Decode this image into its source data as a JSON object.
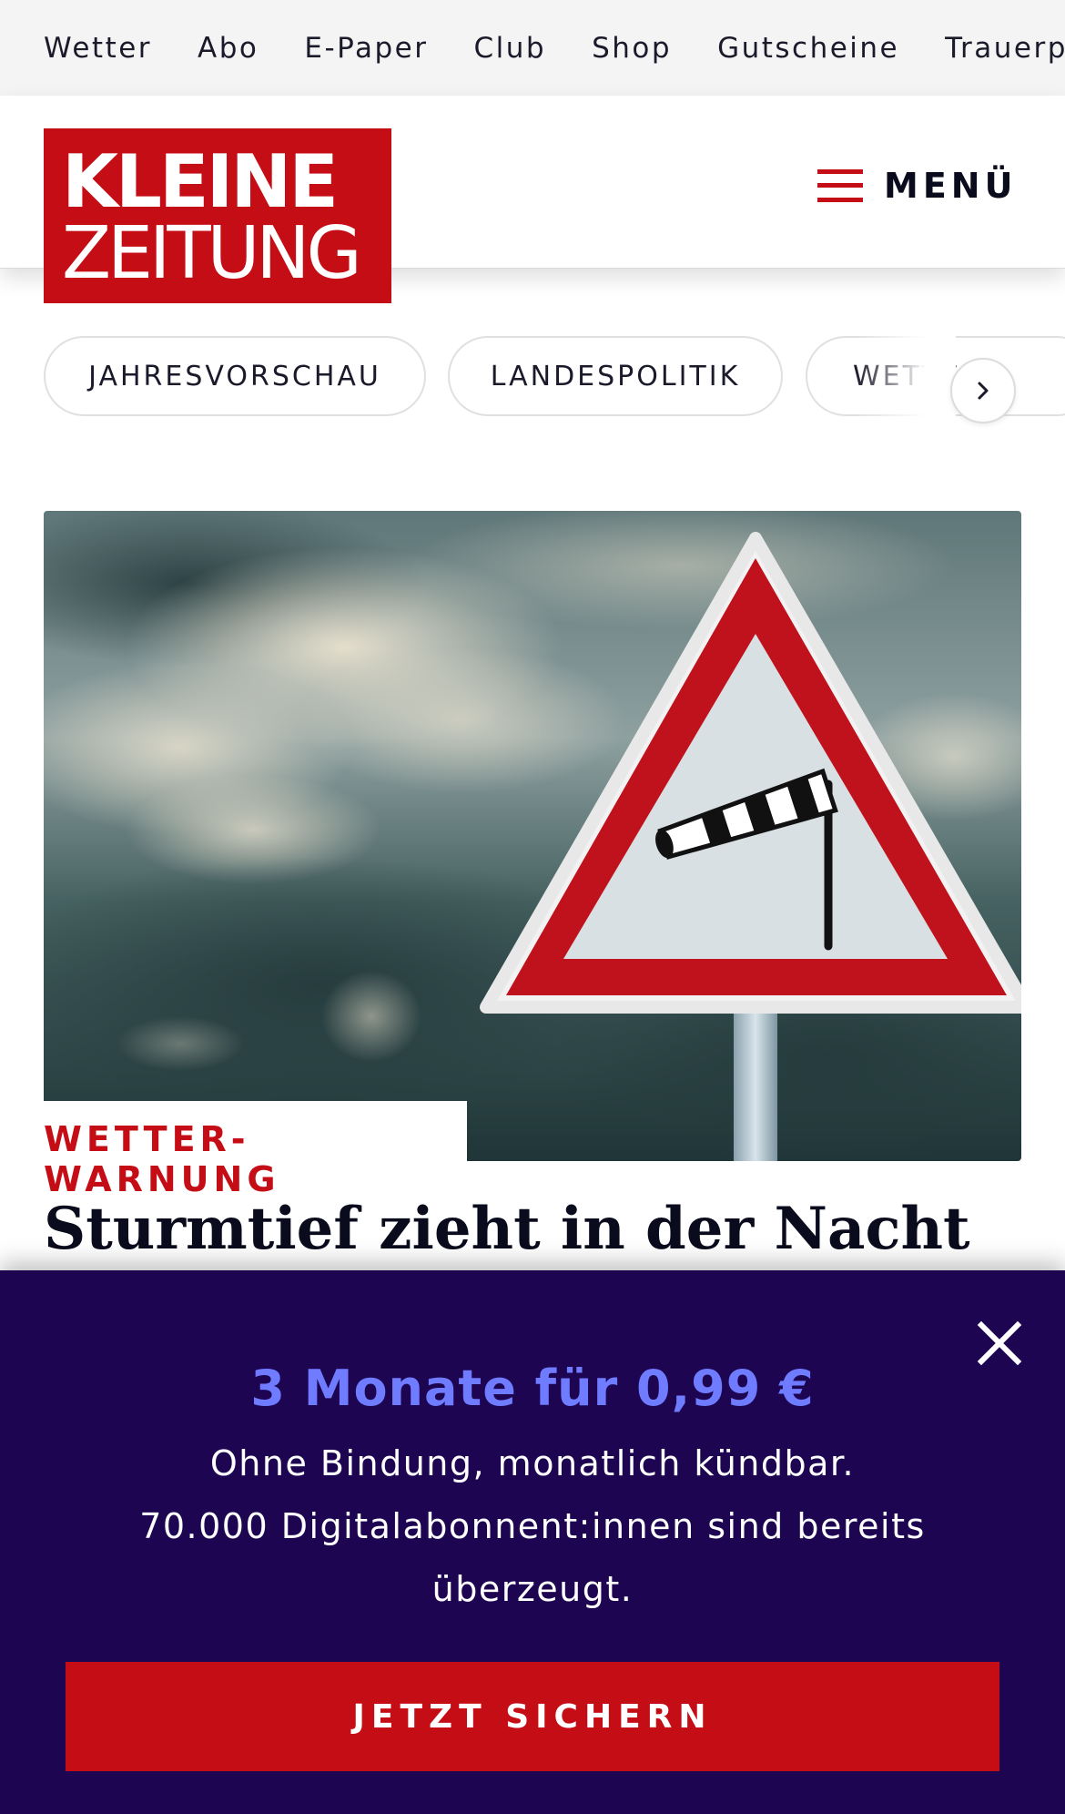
{
  "topnav": {
    "items": [
      "Wetter",
      "Abo",
      "E-Paper",
      "Club",
      "Shop",
      "Gutscheine",
      "Trauerportal"
    ]
  },
  "header": {
    "logo": {
      "line1": "KLEINE",
      "line2": "ZEITUNG"
    },
    "menu_label": "MENÜ",
    "menu_icon": "hamburger-icon"
  },
  "topics": {
    "pills": [
      "JAHRESVORSCHAU",
      "LANDESPOLITIK",
      "WETTER"
    ],
    "next_icon": "chevron-right-icon"
  },
  "article": {
    "image_alt": "Warnschild mit Windsack vor Sturmwolken",
    "kicker": "WETTER-WARNUNG",
    "headline": "Sturmtief zieht in der Nacht"
  },
  "promo": {
    "headline": "3 Monate für 0,99 €",
    "line1": "Ohne Bindung, monatlich kündbar.",
    "line2": "70.000 Digitalabonnent:innen sind bereits überzeugt.",
    "cta_label": "JETZT SICHERN",
    "close_icon": "close-icon"
  },
  "colors": {
    "brand_red": "#c50d16",
    "promo_bg": "#1e0551",
    "promo_accent": "#6f7cff"
  }
}
